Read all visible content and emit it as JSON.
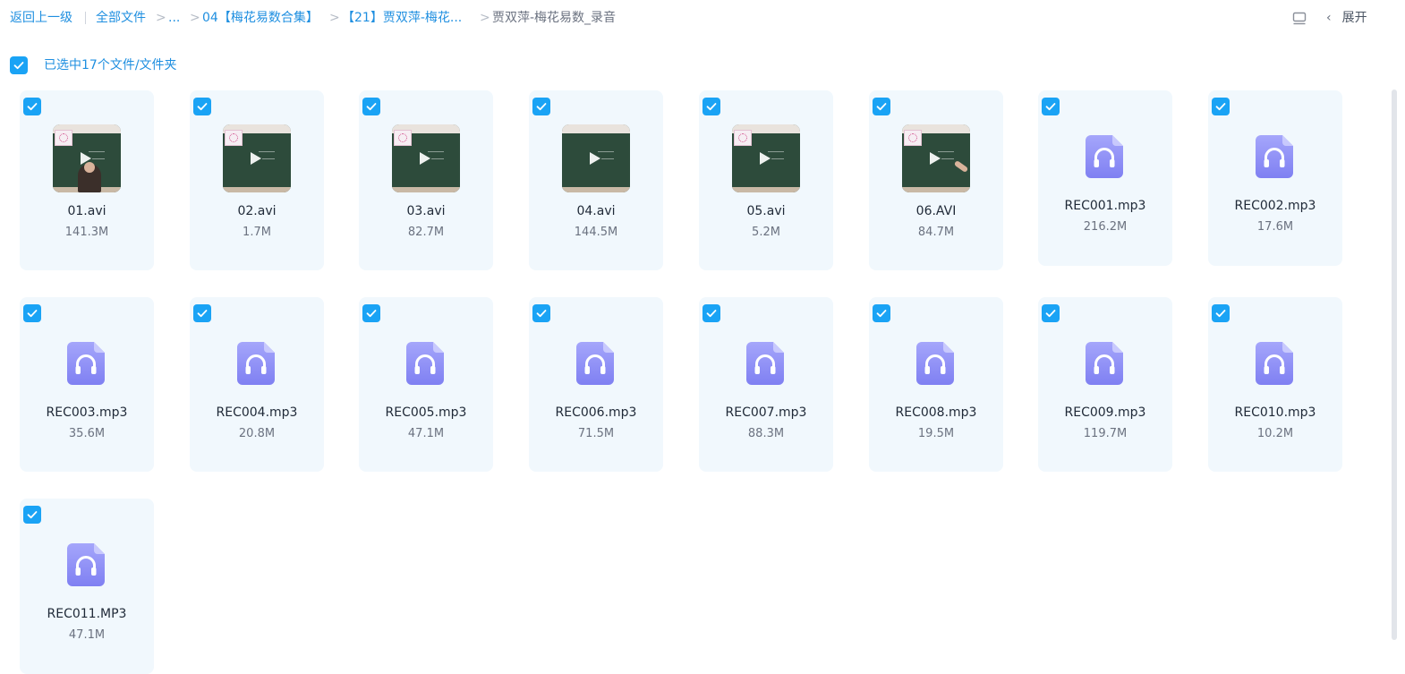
{
  "breadcrumb": {
    "back": "返回上一级",
    "root": "全部文件",
    "sep": ">",
    "ellipsis": "...",
    "level1": "04【梅花易数合集】",
    "level2": "【21】贾双萍-梅花...",
    "current": "贾双萍-梅花易数_录音"
  },
  "toolbar": {
    "expand_label": "展开",
    "expand_chevron": "‹",
    "view_icon": "list-view-icon"
  },
  "selection": {
    "text": "已选中17个文件/文件夹"
  },
  "colors": {
    "accent": "#1aa3f5",
    "link": "#1f8fe0",
    "card_bg": "#f1f8fd",
    "audio_icon": "#8b8cf6"
  },
  "files": [
    {
      "name": "01.avi",
      "size": "141.3M",
      "type": "video"
    },
    {
      "name": "02.avi",
      "size": "1.7M",
      "type": "video"
    },
    {
      "name": "03.avi",
      "size": "82.7M",
      "type": "video"
    },
    {
      "name": "04.avi",
      "size": "144.5M",
      "type": "video"
    },
    {
      "name": "05.avi",
      "size": "5.2M",
      "type": "video"
    },
    {
      "name": "06.AVI",
      "size": "84.7M",
      "type": "video"
    },
    {
      "name": "REC001.mp3",
      "size": "216.2M",
      "type": "audio"
    },
    {
      "name": "REC002.mp3",
      "size": "17.6M",
      "type": "audio"
    },
    {
      "name": "REC003.mp3",
      "size": "35.6M",
      "type": "audio"
    },
    {
      "name": "REC004.mp3",
      "size": "20.8M",
      "type": "audio"
    },
    {
      "name": "REC005.mp3",
      "size": "47.1M",
      "type": "audio"
    },
    {
      "name": "REC006.mp3",
      "size": "71.5M",
      "type": "audio"
    },
    {
      "name": "REC007.mp3",
      "size": "88.3M",
      "type": "audio"
    },
    {
      "name": "REC008.mp3",
      "size": "19.5M",
      "type": "audio"
    },
    {
      "name": "REC009.mp3",
      "size": "119.7M",
      "type": "audio"
    },
    {
      "name": "REC010.mp3",
      "size": "10.2M",
      "type": "audio"
    },
    {
      "name": "REC011.MP3",
      "size": "47.1M",
      "type": "audio"
    }
  ]
}
